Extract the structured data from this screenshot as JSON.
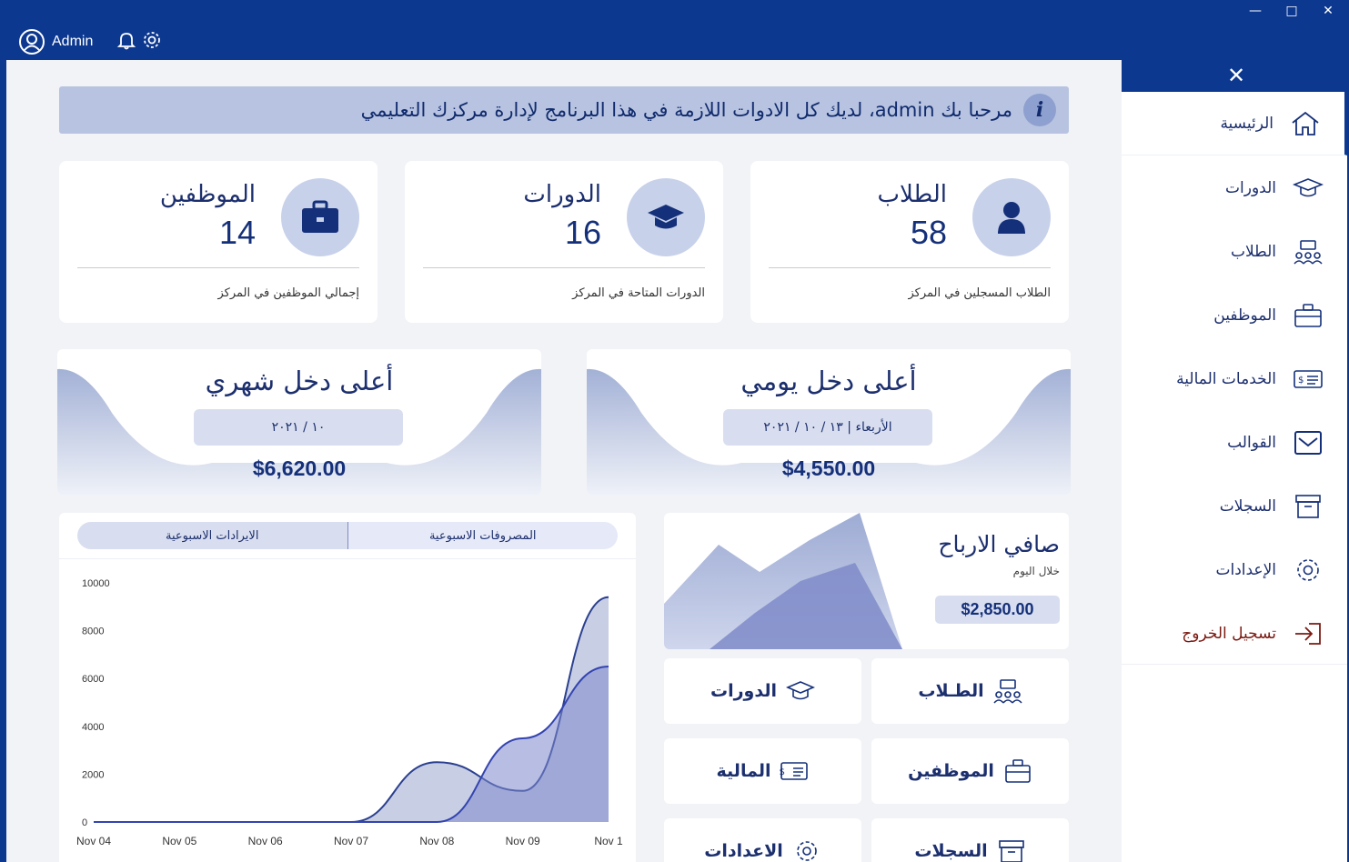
{
  "topbar": {
    "user_name": "Admin",
    "win_minimize": "—",
    "win_maximize": "□",
    "win_close": "✕"
  },
  "welcome": {
    "text": "مرحبا بك admin، لديك كل الادوات اللازمة في هذا البرنامج لإدارة مركزك التعليمي",
    "icon_label": "i"
  },
  "stats": [
    {
      "title": "الطلاب",
      "value": "58",
      "desc": "الطلاب المسجلين في المركز",
      "icon": "user-icon"
    },
    {
      "title": "الدورات",
      "value": "16",
      "desc": "الدورات المتاحة في المركز",
      "icon": "graduation-cap-icon"
    },
    {
      "title": "الموظفين",
      "value": "14",
      "desc": "إجمالي الموظفين في المركز",
      "icon": "briefcase-icon"
    }
  ],
  "income": {
    "daily": {
      "title": "أعلى دخل يومي",
      "date": "الأربعاء | ١٣ / ١٠ / ٢٠٢١",
      "amount": "$4,550.00"
    },
    "monthly": {
      "title": "أعلى دخل شهري",
      "date": "١٠ / ٢٠٢١",
      "amount": "$6,620.00"
    }
  },
  "chart_tabs": {
    "expenses": "المصروفات الاسبوعية",
    "revenue": "الايرادات الاسبوعية"
  },
  "chart_data": {
    "type": "area",
    "x": [
      "Nov 04",
      "Nov 05",
      "Nov 06",
      "Nov 07",
      "Nov 08",
      "Nov 09",
      "Nov 1"
    ],
    "y_ticks": [
      "0",
      "2000",
      "4000",
      "6000",
      "8000",
      "10000"
    ],
    "ylim": [
      0,
      10000
    ],
    "series": [
      {
        "values": [
          0,
          0,
          0,
          0,
          2500,
          1300,
          9400
        ],
        "color": "#9aa8d0",
        "line": "#2a3f8f"
      },
      {
        "values": [
          0,
          0,
          0,
          0,
          0,
          3500,
          6500
        ],
        "color": "#7d88cc",
        "line": "#3344b0"
      }
    ]
  },
  "profit": {
    "title": "صافي الارباح",
    "subtitle": "خلال اليوم",
    "value": "$2,850.00"
  },
  "quick_links": [
    {
      "label": "الطـلاب",
      "icon": "students-icon"
    },
    {
      "label": "الدورات",
      "icon": "graduation-cap-icon"
    },
    {
      "label": "الموظفين",
      "icon": "briefcase-icon"
    },
    {
      "label": "المالية",
      "icon": "finance-icon"
    },
    {
      "label": "السجلات",
      "icon": "archive-icon"
    },
    {
      "label": "الاعدادات",
      "icon": "gear-icon"
    }
  ],
  "sidebar": {
    "close": "✕",
    "items": [
      {
        "label": "الرئيسية",
        "icon": "home-icon"
      },
      {
        "label": "الدورات",
        "icon": "graduation-cap-icon"
      },
      {
        "label": "الطلاب",
        "icon": "students-icon"
      },
      {
        "label": "الموظفين",
        "icon": "briefcase-icon"
      },
      {
        "label": "الخدمات المالية",
        "icon": "finance-icon"
      },
      {
        "label": "القوالب",
        "icon": "mail-icon"
      },
      {
        "label": "السجلات",
        "icon": "archive-icon"
      },
      {
        "label": "الإعدادات",
        "icon": "gear-icon"
      },
      {
        "label": "تسجيل الخروج",
        "icon": "logout-icon"
      }
    ]
  },
  "colors": {
    "primary": "#0c3890",
    "banner": "#b7c3e0",
    "circle": "#c7d1ea",
    "logout": "#7a1a12"
  }
}
